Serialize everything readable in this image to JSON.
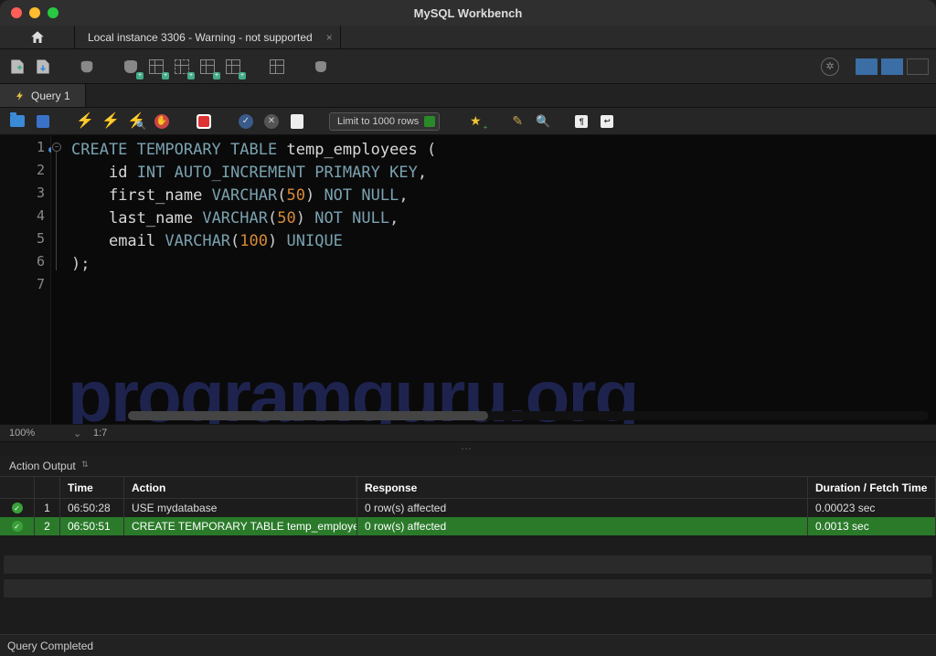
{
  "window": {
    "title": "MySQL Workbench"
  },
  "connection_tab": {
    "label": "Local instance 3306 - Warning - not supported"
  },
  "query_tab": {
    "label": "Query 1"
  },
  "editor_toolbar": {
    "limit_label": "Limit to 1000 rows"
  },
  "code": {
    "lines": [
      "CREATE TEMPORARY TABLE temp_employees (",
      "    id INT AUTO_INCREMENT PRIMARY KEY,",
      "    first_name VARCHAR(50) NOT NULL,",
      "    last_name VARCHAR(50) NOT NULL,",
      "    email VARCHAR(100) UNIQUE",
      ");",
      ""
    ]
  },
  "watermark": "programguru.org",
  "editor_status": {
    "zoom": "100%",
    "pos": "1:7"
  },
  "output": {
    "header_label": "Action Output",
    "columns": {
      "time": "Time",
      "action": "Action",
      "response": "Response",
      "duration": "Duration / Fetch Time"
    },
    "rows": [
      {
        "idx": "1",
        "time": "06:50:28",
        "action": "USE mydatabase",
        "response": "0 row(s) affected",
        "duration": "0.00023 sec"
      },
      {
        "idx": "2",
        "time": "06:50:51",
        "action": "CREATE TEMPORARY TABLE temp_employee…",
        "response": "0 row(s) affected",
        "duration": "0.0013 sec"
      }
    ]
  },
  "footer": {
    "status": "Query Completed"
  }
}
